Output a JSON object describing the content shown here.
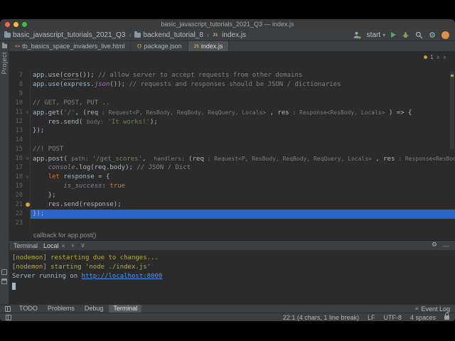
{
  "titlebar": {
    "title": "basic_javascript_tutorials_2021_Q3 — index.js"
  },
  "navbar": {
    "breadcrumbs": [
      "basic_javascript_tutorials_2021_Q3",
      "backend_tutorial_8",
      "index.js"
    ],
    "run_config_label": "start"
  },
  "left_toolbar": {
    "top_label": "Project"
  },
  "editor_tabs": [
    {
      "label": "tb_basics_space_invaders_live.html",
      "icon": "html",
      "active": false
    },
    {
      "label": "package.json",
      "icon": "json",
      "active": false
    },
    {
      "label": "index.js",
      "icon": "js",
      "active": true
    }
  ],
  "editor": {
    "inspection_count": "1",
    "lines": [
      {
        "n": 7,
        "seg": [
          [
            "plain",
            "app.use("
          ],
          [
            "uline",
            "cors"
          ],
          [
            "plain",
            "()); "
          ],
          [
            "com",
            "// allow server to accept requests from other domains"
          ]
        ]
      },
      {
        "n": 8,
        "seg": [
          [
            "plain",
            "app.use(express."
          ],
          [
            "prop",
            "json"
          ],
          [
            "plain",
            "()); "
          ],
          [
            "com",
            "// requests and responses should be JSON / dictionaries"
          ]
        ]
      },
      {
        "n": 9,
        "seg": []
      },
      {
        "n": 10,
        "seg": [
          [
            "com",
            "// GET, POST, PUT .."
          ]
        ]
      },
      {
        "n": 11,
        "fold": true,
        "seg": [
          [
            "plain",
            "app.get("
          ],
          [
            "str",
            "'/'"
          ],
          [
            "plain",
            ", (req"
          ],
          [
            "hint",
            " : Request<P, ResBody, ReqBody, ReqQuery, Locals>"
          ],
          [
            "plain",
            " , res"
          ],
          [
            "hint",
            " : Response<ResBody, Locals>"
          ],
          [
            "plain",
            " ) => {"
          ]
        ]
      },
      {
        "n": 12,
        "seg": [
          [
            "plain",
            "    res.send( "
          ],
          [
            "hint",
            "body:"
          ],
          [
            "str",
            " 'It works!'"
          ],
          [
            "plain",
            ");"
          ]
        ]
      },
      {
        "n": 13,
        "seg": [
          [
            "plain",
            "});"
          ]
        ]
      },
      {
        "n": 14,
        "seg": []
      },
      {
        "n": 15,
        "seg": [
          [
            "com",
            "//! POST"
          ]
        ]
      },
      {
        "n": 16,
        "fold": true,
        "seg": [
          [
            "plain",
            "app.post( "
          ],
          [
            "hint",
            "path:"
          ],
          [
            "str",
            " '/get_scores'"
          ],
          [
            "plain",
            ",  "
          ],
          [
            "hint",
            "handlers:"
          ],
          [
            "plain",
            " (req"
          ],
          [
            "hint",
            " : Request<P, ResBody, ReqBody, ReqQuery, Locals>"
          ],
          [
            "plain",
            " , res"
          ],
          [
            "hint",
            " : Response<ResBody, Locals>"
          ],
          [
            "plain",
            " ) => {"
          ]
        ]
      },
      {
        "n": 17,
        "seg": [
          [
            "plain",
            "    "
          ],
          [
            "prop",
            "console"
          ],
          [
            "plain",
            ".log(req.body); "
          ],
          [
            "com",
            "// JSON / Dict"
          ]
        ]
      },
      {
        "n": 18,
        "fold": true,
        "seg": [
          [
            "plain",
            "    "
          ],
          [
            "kw",
            "let"
          ],
          [
            "plain",
            " response = {"
          ]
        ]
      },
      {
        "n": 19,
        "seg": [
          [
            "plain",
            "        "
          ],
          [
            "prop",
            "is_success"
          ],
          [
            "plain",
            ": "
          ],
          [
            "kw",
            "true"
          ]
        ]
      },
      {
        "n": 20,
        "seg": [
          [
            "plain",
            "    };"
          ]
        ]
      },
      {
        "n": 21,
        "bulb": true,
        "seg": [
          [
            "plain",
            "    res.send(response);"
          ]
        ]
      },
      {
        "n": 22,
        "selected": true,
        "seg": [
          [
            "plain",
            "});"
          ]
        ]
      },
      {
        "n": 23,
        "seg": []
      }
    ]
  },
  "breadcrumb_bar": {
    "text": "callback for app.post()"
  },
  "terminal": {
    "label": "Terminal",
    "tab_label": "Local",
    "lines": [
      {
        "seg": [
          [
            "nodemon",
            "[nodemon] restarting due to changes..."
          ]
        ]
      },
      {
        "seg": [
          [
            "nodemon",
            "[nodemon] starting 'node ./index.js'"
          ]
        ]
      },
      {
        "seg": [
          [
            "plain",
            "Server running on "
          ],
          [
            "link",
            "http://localhost:8000"
          ]
        ]
      }
    ]
  },
  "bottom_bar": {
    "items": [
      {
        "label": "TODO",
        "active": false
      },
      {
        "label": "Problems",
        "active": false
      },
      {
        "label": "Debug",
        "active": false
      },
      {
        "label": "Terminal",
        "active": true
      }
    ],
    "event_log_label": "Event Log"
  },
  "status_bar": {
    "caret": "22:1 (4 chars, 1 line break)",
    "line_sep": "LF",
    "encoding": "UTF-8",
    "indent": "4 spaces"
  },
  "colors": {
    "selection_blue": "#2a64c8",
    "nodemon_yellow": "#b3ae3c",
    "link_blue": "#5394ec",
    "editor_bg": "#2b2b2b",
    "chrome_bg": "#3c3f41"
  }
}
